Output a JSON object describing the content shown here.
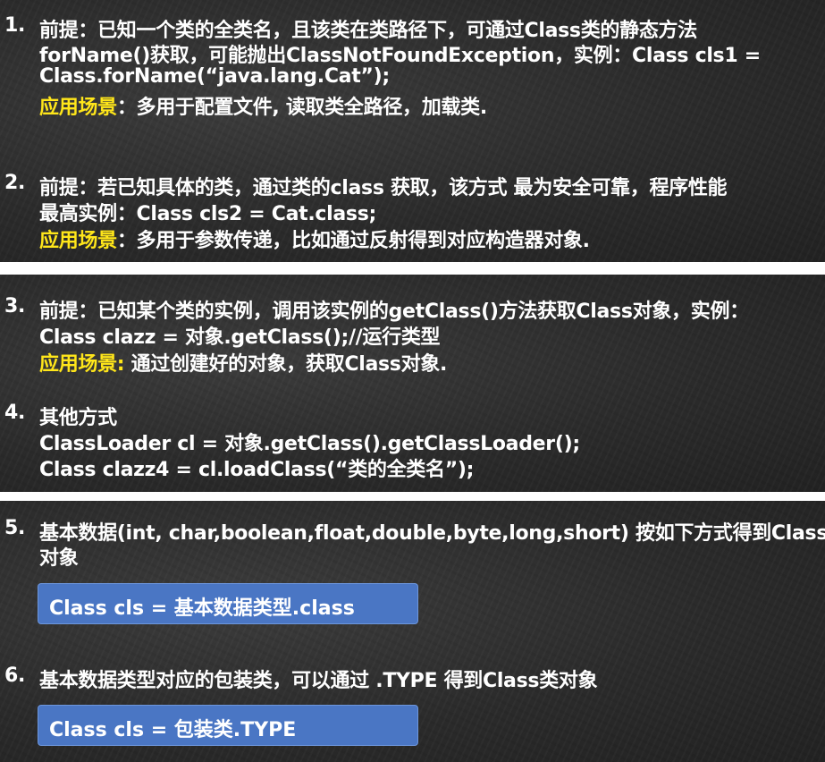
{
  "items": [
    {
      "num": "1.",
      "lines": [
        "前提：已知一个类的全类名，且该类在类路径下，可通过Class类的静态方法",
        "forName()获取，可能抛出ClassNotFoundException，实例：Class cls1 =",
        "Class.forName(“java.lang.Cat”);"
      ],
      "scene_label": "应用场景",
      "scene_text": "：多用于配置文件, 读取类全路径，加载类."
    },
    {
      "num": "2.",
      "lines": [
        "前提：若已知具体的类，通过类的class 获取，该方式 最为安全可靠，程序性能",
        "最高实例：Class cls2 = Cat.class;"
      ],
      "scene_label": "应用场景",
      "scene_text": "：多用于参数传递，比如通过反射得到对应构造器对象."
    },
    {
      "num": "3.",
      "lines": [
        "前提：已知某个类的实例，调用该实例的getClass()方法获取Class对象，实例：",
        "Class clazz =  对象.getClass();//运行类型"
      ],
      "scene_label": "应用场景:",
      "scene_text": " 通过创建好的对象，获取Class对象."
    },
    {
      "num": "4.",
      "lines": [
        "其他方式",
        "ClassLoader cl = 对象.getClass().getClassLoader();",
        "Class clazz4 = cl.loadClass(“类的全类名”);"
      ]
    },
    {
      "num": "5.",
      "lines": [
        "基本数据(int, char,boolean,float,double,byte,long,short) 按如下方式得到Class类",
        "对象"
      ],
      "code": "Class cls = 基本数据类型.class"
    },
    {
      "num": "6.",
      "lines": [
        "基本数据类型对应的包装类，可以通过 .TYPE 得到Class类对象"
      ],
      "code": "Class cls = 包装类.TYPE"
    }
  ]
}
